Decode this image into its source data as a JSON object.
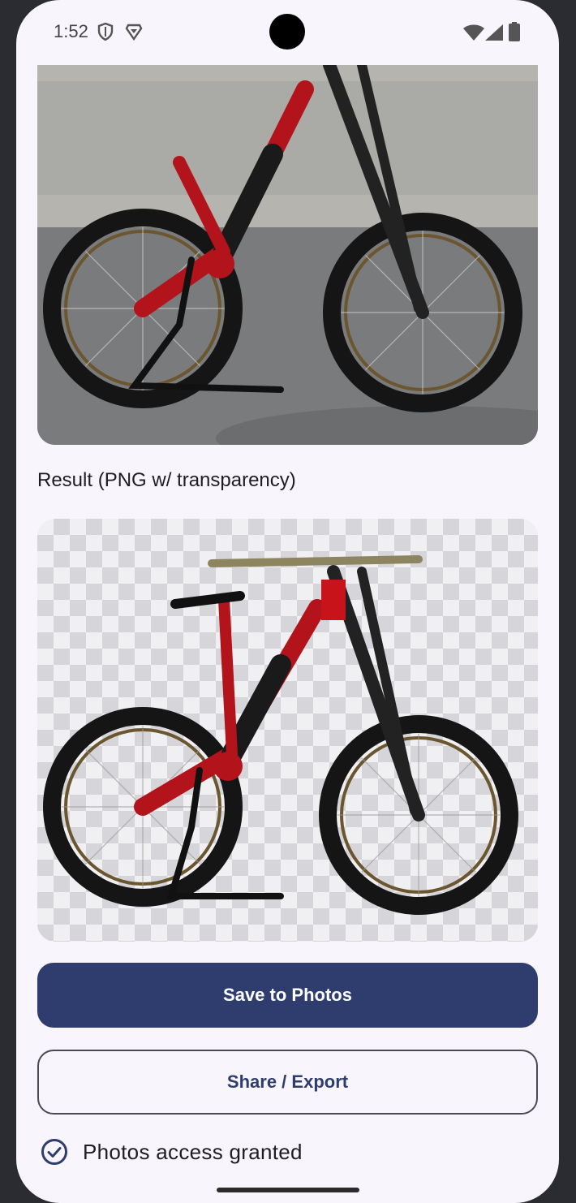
{
  "status_bar": {
    "time": "1:52"
  },
  "original_photo": {
    "alt": "Red and black downhill mountain bike on a stand"
  },
  "result": {
    "caption": "Result (PNG w/ transparency)",
    "alt": "Mountain bike with background removed"
  },
  "actions": {
    "save_label": "Save to Photos",
    "share_label": "Share / Export"
  },
  "permission": {
    "label": "Photos access granted"
  },
  "colors": {
    "primary": "#2f3d6e",
    "background": "#f8f5fc"
  }
}
